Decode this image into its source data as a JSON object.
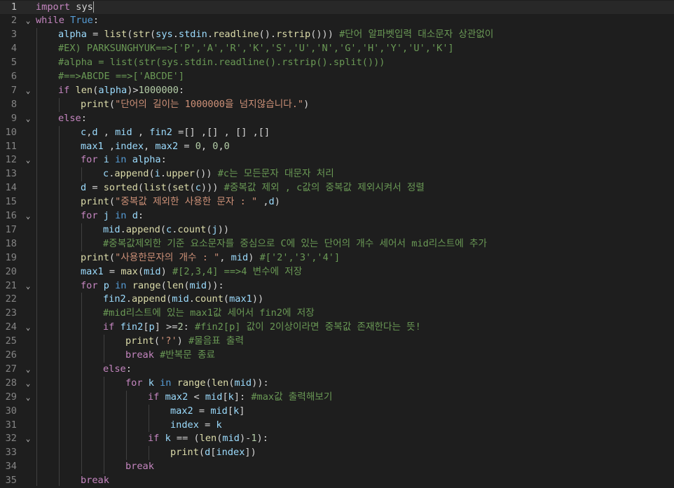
{
  "colors": {
    "background": "#1e1e1e",
    "current_line": "#282828",
    "line_number": "#858585",
    "keyword_control": "#c586c0",
    "keyword": "#569cd6",
    "function": "#dcdcaa",
    "variable": "#9cdcfe",
    "string": "#ce9178",
    "number": "#b5cea8",
    "comment": "#6a9955",
    "plain": "#d4d4d4"
  },
  "editor": {
    "current_line": 1,
    "lines": [
      {
        "n": "1",
        "fold": false,
        "indent": 0,
        "tokens": [
          [
            "kw",
            "import"
          ],
          [
            "pl",
            " sys"
          ]
        ]
      },
      {
        "n": "2",
        "fold": true,
        "indent": 0,
        "tokens": [
          [
            "kw",
            "while"
          ],
          [
            "pl",
            " "
          ],
          [
            "kb",
            "True"
          ],
          [
            "pl",
            ":"
          ]
        ]
      },
      {
        "n": "3",
        "fold": false,
        "indent": 1,
        "tokens": [
          [
            "va",
            "alpha"
          ],
          [
            "pl",
            " = "
          ],
          [
            "fn",
            "list"
          ],
          [
            "pl",
            "("
          ],
          [
            "fn",
            "str"
          ],
          [
            "pl",
            "("
          ],
          [
            "va",
            "sys"
          ],
          [
            "pl",
            "."
          ],
          [
            "va",
            "stdin"
          ],
          [
            "pl",
            "."
          ],
          [
            "fn",
            "readline"
          ],
          [
            "pl",
            "()."
          ],
          [
            "fn",
            "rstrip"
          ],
          [
            "pl",
            "())) "
          ],
          [
            "cm",
            "#단어 알파벳입력 대소문자 상관없이"
          ]
        ]
      },
      {
        "n": "4",
        "fold": false,
        "indent": 1,
        "tokens": [
          [
            "cm",
            "#EX) PARKSUNGHYUK==>['P','A','R','K','S','U','N','G','H','Y','U','K']"
          ]
        ]
      },
      {
        "n": "5",
        "fold": false,
        "indent": 1,
        "tokens": [
          [
            "cm",
            "#alpha = list(str(sys.stdin.readline().rstrip().split()))"
          ]
        ]
      },
      {
        "n": "6",
        "fold": false,
        "indent": 1,
        "tokens": [
          [
            "cm",
            "#==>ABCDE ==>['ABCDE']"
          ]
        ]
      },
      {
        "n": "7",
        "fold": true,
        "indent": 1,
        "tokens": [
          [
            "kw",
            "if"
          ],
          [
            "pl",
            " "
          ],
          [
            "fn",
            "len"
          ],
          [
            "pl",
            "("
          ],
          [
            "va",
            "alpha"
          ],
          [
            "pl",
            ")>"
          ],
          [
            "nu",
            "1000000"
          ],
          [
            "pl",
            ":"
          ]
        ]
      },
      {
        "n": "8",
        "fold": false,
        "indent": 2,
        "tokens": [
          [
            "fn",
            "print"
          ],
          [
            "pl",
            "("
          ],
          [
            "st",
            "\"단어의 길이는 1000000을 넘지않습니다.\""
          ],
          [
            "pl",
            ")"
          ]
        ]
      },
      {
        "n": "9",
        "fold": true,
        "indent": 1,
        "tokens": [
          [
            "kw",
            "else"
          ],
          [
            "pl",
            ":"
          ]
        ]
      },
      {
        "n": "10",
        "fold": false,
        "indent": 2,
        "tokens": [
          [
            "va",
            "c"
          ],
          [
            "pl",
            ","
          ],
          [
            "va",
            "d"
          ],
          [
            "pl",
            " , "
          ],
          [
            "va",
            "mid"
          ],
          [
            "pl",
            " , "
          ],
          [
            "va",
            "fin2"
          ],
          [
            "pl",
            " =[] ,[] , [] ,[]"
          ]
        ]
      },
      {
        "n": "11",
        "fold": false,
        "indent": 2,
        "tokens": [
          [
            "va",
            "max1"
          ],
          [
            "pl",
            " ,"
          ],
          [
            "va",
            "index"
          ],
          [
            "pl",
            ", "
          ],
          [
            "va",
            "max2"
          ],
          [
            "pl",
            " = "
          ],
          [
            "nu",
            "0"
          ],
          [
            "pl",
            ", "
          ],
          [
            "nu",
            "0"
          ],
          [
            "pl",
            ","
          ],
          [
            "nu",
            "0"
          ]
        ]
      },
      {
        "n": "12",
        "fold": true,
        "indent": 2,
        "tokens": [
          [
            "kw",
            "for"
          ],
          [
            "pl",
            " "
          ],
          [
            "va",
            "i"
          ],
          [
            "pl",
            " "
          ],
          [
            "kb",
            "in"
          ],
          [
            "pl",
            " "
          ],
          [
            "va",
            "alpha"
          ],
          [
            "pl",
            ":"
          ]
        ]
      },
      {
        "n": "13",
        "fold": false,
        "indent": 3,
        "tokens": [
          [
            "va",
            "c"
          ],
          [
            "pl",
            "."
          ],
          [
            "fn",
            "append"
          ],
          [
            "pl",
            "("
          ],
          [
            "va",
            "i"
          ],
          [
            "pl",
            "."
          ],
          [
            "fn",
            "upper"
          ],
          [
            "pl",
            "()) "
          ],
          [
            "cm",
            "#c는 모든문자 대문자 처리"
          ]
        ]
      },
      {
        "n": "14",
        "fold": false,
        "indent": 2,
        "tokens": [
          [
            "va",
            "d"
          ],
          [
            "pl",
            " = "
          ],
          [
            "fn",
            "sorted"
          ],
          [
            "pl",
            "("
          ],
          [
            "fn",
            "list"
          ],
          [
            "pl",
            "("
          ],
          [
            "fn",
            "set"
          ],
          [
            "pl",
            "("
          ],
          [
            "va",
            "c"
          ],
          [
            "pl",
            "))) "
          ],
          [
            "cm",
            "#중복값 제외 , c값의 중복값 제외시켜서 정렬"
          ]
        ]
      },
      {
        "n": "15",
        "fold": false,
        "indent": 2,
        "tokens": [
          [
            "fn",
            "print"
          ],
          [
            "pl",
            "("
          ],
          [
            "st",
            "\"중복값 제외한 사용한 문자 : \""
          ],
          [
            "pl",
            " ,"
          ],
          [
            "va",
            "d"
          ],
          [
            "pl",
            ")"
          ]
        ]
      },
      {
        "n": "16",
        "fold": true,
        "indent": 2,
        "tokens": [
          [
            "kw",
            "for"
          ],
          [
            "pl",
            " "
          ],
          [
            "va",
            "j"
          ],
          [
            "pl",
            " "
          ],
          [
            "kb",
            "in"
          ],
          [
            "pl",
            " "
          ],
          [
            "va",
            "d"
          ],
          [
            "pl",
            ":"
          ]
        ]
      },
      {
        "n": "17",
        "fold": false,
        "indent": 3,
        "tokens": [
          [
            "va",
            "mid"
          ],
          [
            "pl",
            "."
          ],
          [
            "fn",
            "append"
          ],
          [
            "pl",
            "("
          ],
          [
            "va",
            "c"
          ],
          [
            "pl",
            "."
          ],
          [
            "fn",
            "count"
          ],
          [
            "pl",
            "("
          ],
          [
            "va",
            "j"
          ],
          [
            "pl",
            "))"
          ]
        ]
      },
      {
        "n": "18",
        "fold": false,
        "indent": 3,
        "tokens": [
          [
            "cm",
            "#중복값제외한 기준 요소문자를 중심으로 C에 있는 단어의 개수 세어서 mid리스트에 추가"
          ]
        ]
      },
      {
        "n": "19",
        "fold": false,
        "indent": 2,
        "tokens": [
          [
            "fn",
            "print"
          ],
          [
            "pl",
            "("
          ],
          [
            "st",
            "\"사용한문자의 개수 : \""
          ],
          [
            "pl",
            ", "
          ],
          [
            "va",
            "mid"
          ],
          [
            "pl",
            ") "
          ],
          [
            "cm",
            "#['2','3','4']"
          ]
        ]
      },
      {
        "n": "20",
        "fold": false,
        "indent": 2,
        "tokens": [
          [
            "va",
            "max1"
          ],
          [
            "pl",
            " = "
          ],
          [
            "fn",
            "max"
          ],
          [
            "pl",
            "("
          ],
          [
            "va",
            "mid"
          ],
          [
            "pl",
            ") "
          ],
          [
            "cm",
            "#[2,3,4] ==>4 변수에 저장"
          ]
        ]
      },
      {
        "n": "21",
        "fold": true,
        "indent": 2,
        "tokens": [
          [
            "kw",
            "for"
          ],
          [
            "pl",
            " "
          ],
          [
            "va",
            "p"
          ],
          [
            "pl",
            " "
          ],
          [
            "kb",
            "in"
          ],
          [
            "pl",
            " "
          ],
          [
            "fn",
            "range"
          ],
          [
            "pl",
            "("
          ],
          [
            "fn",
            "len"
          ],
          [
            "pl",
            "("
          ],
          [
            "va",
            "mid"
          ],
          [
            "pl",
            ")):"
          ]
        ]
      },
      {
        "n": "22",
        "fold": false,
        "indent": 3,
        "tokens": [
          [
            "va",
            "fin2"
          ],
          [
            "pl",
            "."
          ],
          [
            "fn",
            "append"
          ],
          [
            "pl",
            "("
          ],
          [
            "va",
            "mid"
          ],
          [
            "pl",
            "."
          ],
          [
            "fn",
            "count"
          ],
          [
            "pl",
            "("
          ],
          [
            "va",
            "max1"
          ],
          [
            "pl",
            "))"
          ]
        ]
      },
      {
        "n": "23",
        "fold": false,
        "indent": 3,
        "tokens": [
          [
            "cm",
            "#mid리스트에 있는 max1값 세어서 fin2에 저장"
          ]
        ]
      },
      {
        "n": "24",
        "fold": true,
        "indent": 3,
        "tokens": [
          [
            "kw",
            "if"
          ],
          [
            "pl",
            " "
          ],
          [
            "va",
            "fin2"
          ],
          [
            "pl",
            "["
          ],
          [
            "va",
            "p"
          ],
          [
            "pl",
            "] >="
          ],
          [
            "nu",
            "2"
          ],
          [
            "pl",
            ": "
          ],
          [
            "cm",
            "#fin2[p] 값이 2이상이라면 중복값 존재한다는 뜻!"
          ]
        ]
      },
      {
        "n": "25",
        "fold": false,
        "indent": 4,
        "tokens": [
          [
            "fn",
            "print"
          ],
          [
            "pl",
            "("
          ],
          [
            "st",
            "'?'"
          ],
          [
            "pl",
            ") "
          ],
          [
            "cm",
            "#물음표 출력"
          ]
        ]
      },
      {
        "n": "26",
        "fold": false,
        "indent": 4,
        "tokens": [
          [
            "kw",
            "break"
          ],
          [
            "pl",
            " "
          ],
          [
            "cm",
            "#반복문 종료"
          ]
        ]
      },
      {
        "n": "27",
        "fold": true,
        "indent": 3,
        "tokens": [
          [
            "kw",
            "else"
          ],
          [
            "pl",
            ":"
          ]
        ]
      },
      {
        "n": "28",
        "fold": true,
        "indent": 4,
        "tokens": [
          [
            "kw",
            "for"
          ],
          [
            "pl",
            " "
          ],
          [
            "va",
            "k"
          ],
          [
            "pl",
            " "
          ],
          [
            "kb",
            "in"
          ],
          [
            "pl",
            " "
          ],
          [
            "fn",
            "range"
          ],
          [
            "pl",
            "("
          ],
          [
            "fn",
            "len"
          ],
          [
            "pl",
            "("
          ],
          [
            "va",
            "mid"
          ],
          [
            "pl",
            ")):"
          ]
        ]
      },
      {
        "n": "29",
        "fold": true,
        "indent": 5,
        "tokens": [
          [
            "kw",
            "if"
          ],
          [
            "pl",
            " "
          ],
          [
            "va",
            "max2"
          ],
          [
            "pl",
            " < "
          ],
          [
            "va",
            "mid"
          ],
          [
            "pl",
            "["
          ],
          [
            "va",
            "k"
          ],
          [
            "pl",
            "]: "
          ],
          [
            "cm",
            "#max값 출력해보기"
          ]
        ]
      },
      {
        "n": "30",
        "fold": false,
        "indent": 6,
        "tokens": [
          [
            "va",
            "max2"
          ],
          [
            "pl",
            " = "
          ],
          [
            "va",
            "mid"
          ],
          [
            "pl",
            "["
          ],
          [
            "va",
            "k"
          ],
          [
            "pl",
            "]"
          ]
        ]
      },
      {
        "n": "31",
        "fold": false,
        "indent": 6,
        "tokens": [
          [
            "va",
            "index"
          ],
          [
            "pl",
            " = "
          ],
          [
            "va",
            "k"
          ]
        ]
      },
      {
        "n": "32",
        "fold": true,
        "indent": 5,
        "tokens": [
          [
            "kw",
            "if"
          ],
          [
            "pl",
            " "
          ],
          [
            "va",
            "k"
          ],
          [
            "pl",
            " == ("
          ],
          [
            "fn",
            "len"
          ],
          [
            "pl",
            "("
          ],
          [
            "va",
            "mid"
          ],
          [
            "pl",
            ")-"
          ],
          [
            "nu",
            "1"
          ],
          [
            "pl",
            "):"
          ]
        ]
      },
      {
        "n": "33",
        "fold": false,
        "indent": 6,
        "tokens": [
          [
            "fn",
            "print"
          ],
          [
            "pl",
            "("
          ],
          [
            "va",
            "d"
          ],
          [
            "pl",
            "["
          ],
          [
            "va",
            "index"
          ],
          [
            "pl",
            "])"
          ]
        ]
      },
      {
        "n": "34",
        "fold": false,
        "indent": 4,
        "tokens": [
          [
            "kw",
            "break"
          ]
        ]
      },
      {
        "n": "35",
        "fold": false,
        "indent": 2,
        "tokens": [
          [
            "kw",
            "break"
          ]
        ]
      }
    ]
  }
}
